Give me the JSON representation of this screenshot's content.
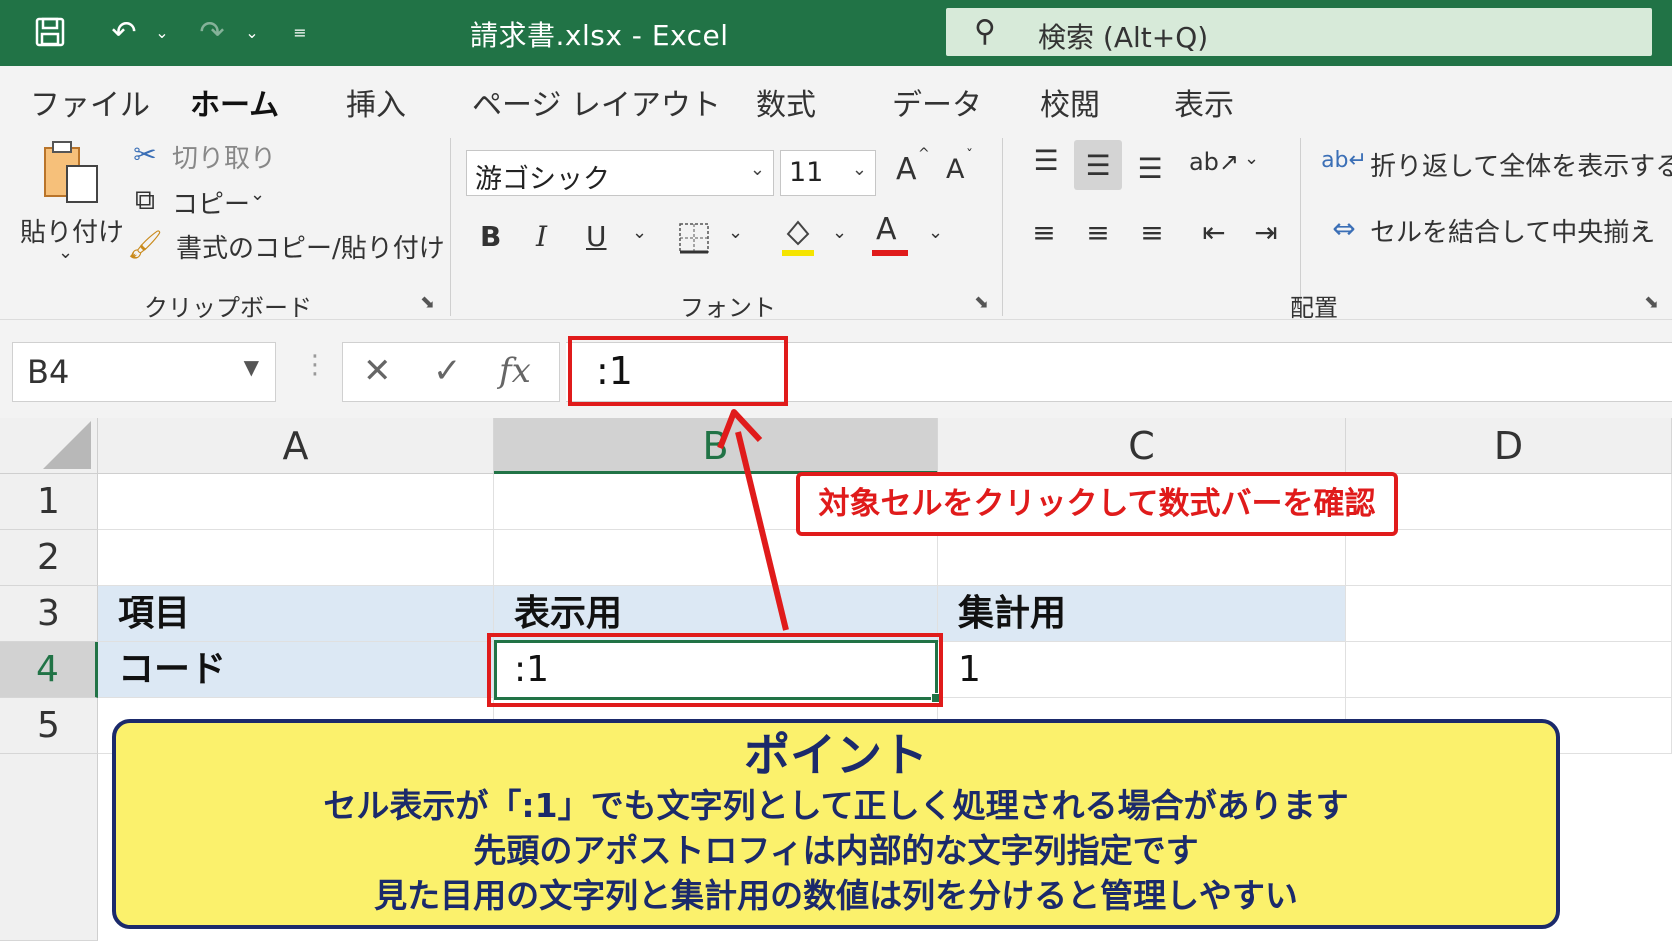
{
  "titlebar": {
    "doc_title": "請求書.xlsx  -  Excel",
    "search_text": "検索 (Alt+Q)",
    "bg_color": "#217346"
  },
  "tabs": [
    "ファイル",
    "ホーム",
    "挿入",
    "ページ レイアウト",
    "数式",
    "データ",
    "校閲",
    "表示"
  ],
  "active_tab": "ホーム",
  "ribbon": {
    "clipboard": {
      "paste_label": "貼り付け",
      "cut_label": "切り取り",
      "copy_label": "コピー",
      "format_painter_label": "書式のコピー/貼り付け",
      "group_label": "クリップボード"
    },
    "font": {
      "font_name": "游ゴシック",
      "font_size": "11",
      "bold": "B",
      "italic": "I",
      "underline": "U",
      "font_color_letter": "A",
      "grow": "A",
      "shrink": "A",
      "group_label": "フォント",
      "fill_color": "#f5e400",
      "text_color": "#e01b1b"
    },
    "alignment": {
      "wrap_label": "折り返して全体を表示する",
      "merge_label": "セルを結合して中央揃え",
      "group_label": "配置"
    }
  },
  "formula_bar": {
    "name_box": "B4",
    "fx": "fx",
    "formula": ":1"
  },
  "sheet": {
    "columns": [
      "A",
      "B",
      "C",
      "D"
    ],
    "rows": [
      "1",
      "2",
      "3",
      "4",
      "5"
    ],
    "selected_column": "B",
    "selected_row": "4",
    "cells": {
      "A3": "項目",
      "B3": "表示用",
      "C3": "集計用",
      "A4": "コード",
      "B4": ":1",
      "C4": "1"
    }
  },
  "callout": {
    "text": "対象セルをクリックして数式バーを確認",
    "color": "#e01b1b"
  },
  "point": {
    "title": "ポイント",
    "lines": [
      "セル表示が「:1」でも文字列として正しく処理される場合があります",
      "先頭のアポストロフィは内部的な文字列指定です",
      "見た目用の文字列と集計用の数値は列を分けると管理しやすい"
    ],
    "bg_color": "#fbf16c",
    "text_color": "#1b2a6b"
  }
}
